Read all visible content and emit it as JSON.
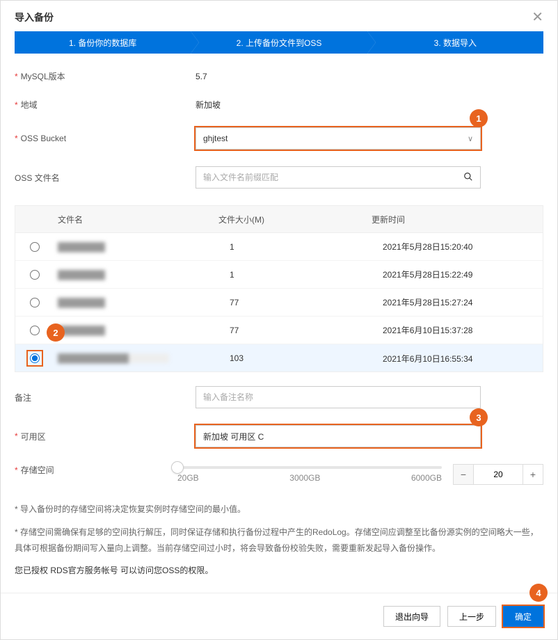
{
  "dialog": {
    "title": "导入备份"
  },
  "steps": [
    "1. 备份你的数据库",
    "2. 上传备份文件到OSS",
    "3. 数据导入"
  ],
  "form": {
    "mysql_label": "MySQL版本",
    "mysql_value": "5.7",
    "region_label": "地域",
    "region_value": "新加坡",
    "bucket_label": "OSS Bucket",
    "bucket_value": "ghjtest",
    "filename_label": "OSS 文件名",
    "filename_placeholder": "输入文件名前缀匹配",
    "remark_label": "备注",
    "remark_placeholder": "输入备注名称",
    "zone_label": "可用区",
    "zone_value": "新加坡 可用区 C",
    "storage_label": "存储空间",
    "storage_value": "20",
    "storage_min": "20GB",
    "storage_mid": "3000GB",
    "storage_max": "6000GB"
  },
  "table": {
    "headers": {
      "name": "文件名",
      "size": "文件大小(M)",
      "time": "更新时间"
    },
    "rows": [
      {
        "name": "████████",
        "size": "1",
        "time": "2021年5月28日15:20:40",
        "selected": false
      },
      {
        "name": "████████",
        "size": "1",
        "time": "2021年5月28日15:22:49",
        "selected": false
      },
      {
        "name": "████████",
        "size": "77",
        "time": "2021年5月28日15:27:24",
        "selected": false
      },
      {
        "name": "████████",
        "size": "77",
        "time": "2021年6月10日15:37:28",
        "selected": false
      },
      {
        "name": "████████████",
        "size": "103",
        "time": "2021年6月10日16:55:34",
        "selected": true
      }
    ]
  },
  "notes": {
    "n1": "* 导入备份时的存储空间将决定恢复实例时存储空间的最小值。",
    "n2": "* 存储空间需确保有足够的空间执行解压，同时保证存储和执行备份过程中产生的RedoLog。存储空间应调整至比备份源实例的空间略大一些，具体可根据备份期间写入量向上调整。当前存储空间过小时，将会导致备份校验失败，需要重新发起导入备份操作。",
    "n3": "您已授权 RDS官方服务帐号 可以访问您OSS的权限。"
  },
  "footer": {
    "exit": "退出向导",
    "prev": "上一步",
    "ok": "确定"
  },
  "annot": {
    "a1": "1",
    "a2": "2",
    "a3": "3",
    "a4": "4"
  }
}
